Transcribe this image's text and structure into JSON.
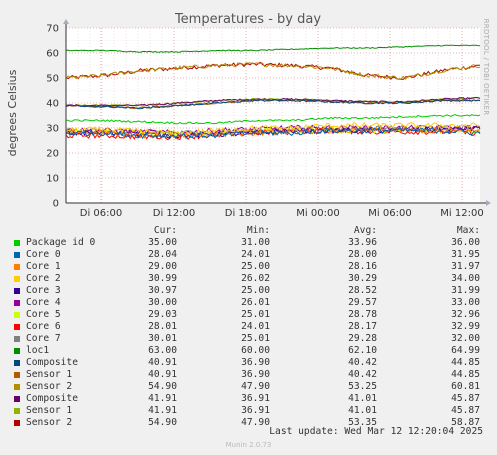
{
  "chart_data": {
    "type": "line",
    "title": "Temperatures - by day",
    "ylabel": "degrees Celsius",
    "side_text": "RRDTOOL / TOBI OETIKER",
    "ylim": [
      0,
      70
    ],
    "y_ticks": [
      0,
      10,
      20,
      30,
      40,
      50,
      60,
      70
    ],
    "x_ticks": [
      "Di 06:00",
      "Di 12:00",
      "Di 18:00",
      "Mi 00:00",
      "Mi 06:00",
      "Mi 12:00"
    ],
    "grid": true,
    "series": [
      {
        "name": "Package id 0",
        "color": "#00cc00",
        "values": [
          33,
          33,
          32.5,
          32,
          32,
          33,
          33,
          34,
          34,
          34.5,
          35,
          35
        ]
      },
      {
        "name": "Core 0",
        "color": "#0066b3",
        "values": [
          28,
          28,
          27,
          27,
          27,
          28,
          28,
          29,
          29,
          29,
          29,
          28
        ]
      },
      {
        "name": "Core 1",
        "color": "#ff8000",
        "values": [
          28,
          28,
          27,
          27,
          27.5,
          28,
          28.5,
          29,
          29,
          29,
          29,
          29
        ]
      },
      {
        "name": "Core 2",
        "color": "#ffcc00",
        "values": [
          29,
          29.5,
          28.5,
          28,
          29,
          30,
          30,
          31,
          31,
          31,
          31,
          31
        ]
      },
      {
        "name": "Core 3",
        "color": "#330099",
        "values": [
          28,
          28,
          27.5,
          27,
          27.5,
          28,
          29,
          29,
          29,
          29,
          29.5,
          30
        ]
      },
      {
        "name": "Core 4",
        "color": "#990099",
        "values": [
          29,
          29,
          28.5,
          28,
          29,
          29.5,
          30,
          30,
          30,
          30,
          30,
          30
        ]
      },
      {
        "name": "Core 5",
        "color": "#ccff00",
        "values": [
          28,
          28.5,
          28,
          27.5,
          28,
          29,
          29,
          29,
          29,
          29,
          29,
          29
        ]
      },
      {
        "name": "Core 6",
        "color": "#ff0000",
        "values": [
          27,
          27,
          26.5,
          26.5,
          27,
          28,
          28.5,
          29,
          28.5,
          28.5,
          28.5,
          28
        ]
      },
      {
        "name": "Core 7",
        "color": "#808080",
        "values": [
          29,
          29,
          28.5,
          28,
          28.5,
          29,
          29.5,
          30,
          30,
          30,
          30,
          30
        ]
      },
      {
        "name": "loc1",
        "color": "#008f00",
        "values": [
          61,
          61,
          60.5,
          60.5,
          61,
          61,
          61.5,
          62,
          62,
          62.5,
          63,
          63
        ]
      },
      {
        "name": "Composite",
        "color": "#00487d",
        "values": [
          39,
          38.5,
          38,
          39,
          40,
          41,
          41,
          40.5,
          40,
          40,
          41,
          41
        ]
      },
      {
        "name": "Sensor 1",
        "color": "#b35a00",
        "values": [
          39,
          38.5,
          38,
          39,
          40,
          41,
          41,
          40.5,
          40,
          40,
          41,
          41
        ]
      },
      {
        "name": "Sensor 2",
        "color": "#b38f00",
        "values": [
          50,
          51,
          53,
          54,
          55,
          55.5,
          55,
          54,
          51,
          50,
          53,
          55
        ]
      },
      {
        "name": "Composite",
        "color": "#6b006b",
        "values": [
          39,
          39,
          39,
          40,
          41,
          41.5,
          41.5,
          41,
          40.5,
          40.5,
          41.5,
          42
        ]
      },
      {
        "name": "Sensor 1",
        "color": "#8fb300",
        "values": [
          39,
          39,
          39,
          40,
          41,
          41.5,
          41.5,
          41,
          40.5,
          40.5,
          41.5,
          42
        ]
      },
      {
        "name": "Sensor 2",
        "color": "#b30000",
        "values": [
          50,
          51,
          53,
          54,
          55,
          55.5,
          55,
          54,
          51,
          50,
          53,
          55
        ]
      }
    ]
  },
  "legend": {
    "headers": [
      "Cur:",
      "Min:",
      "Avg:",
      "Max:"
    ],
    "rows": [
      {
        "name": "Package id 0",
        "color": "#00cc00",
        "cur": "35.00",
        "min": "31.00",
        "avg": "33.96",
        "max": "36.00"
      },
      {
        "name": "Core 0",
        "color": "#0066b3",
        "cur": "28.04",
        "min": "24.01",
        "avg": "28.00",
        "max": "31.95"
      },
      {
        "name": "Core 1",
        "color": "#ff8000",
        "cur": "29.00",
        "min": "25.00",
        "avg": "28.16",
        "max": "31.97"
      },
      {
        "name": "Core 2",
        "color": "#ffcc00",
        "cur": "30.99",
        "min": "26.02",
        "avg": "30.29",
        "max": "34.00"
      },
      {
        "name": "Core 3",
        "color": "#330099",
        "cur": "30.97",
        "min": "25.00",
        "avg": "28.52",
        "max": "31.99"
      },
      {
        "name": "Core 4",
        "color": "#990099",
        "cur": "30.00",
        "min": "26.01",
        "avg": "29.57",
        "max": "33.00"
      },
      {
        "name": "Core 5",
        "color": "#ccff00",
        "cur": "29.03",
        "min": "25.01",
        "avg": "28.78",
        "max": "32.96"
      },
      {
        "name": "Core 6",
        "color": "#ff0000",
        "cur": "28.01",
        "min": "24.01",
        "avg": "28.17",
        "max": "32.99"
      },
      {
        "name": "Core 7",
        "color": "#808080",
        "cur": "30.01",
        "min": "25.01",
        "avg": "29.28",
        "max": "32.00"
      },
      {
        "name": "loc1",
        "color": "#008f00",
        "cur": "63.00",
        "min": "60.00",
        "avg": "62.10",
        "max": "64.99"
      },
      {
        "name": "Composite",
        "color": "#00487d",
        "cur": "40.91",
        "min": "36.90",
        "avg": "40.42",
        "max": "44.85"
      },
      {
        "name": "Sensor 1",
        "color": "#b35a00",
        "cur": "40.91",
        "min": "36.90",
        "avg": "40.42",
        "max": "44.85"
      },
      {
        "name": "Sensor 2",
        "color": "#b38f00",
        "cur": "54.90",
        "min": "47.90",
        "avg": "53.25",
        "max": "60.81"
      },
      {
        "name": "Composite",
        "color": "#6b006b",
        "cur": "41.91",
        "min": "36.91",
        "avg": "41.01",
        "max": "45.87"
      },
      {
        "name": "Sensor 1",
        "color": "#8fb300",
        "cur": "41.91",
        "min": "36.91",
        "avg": "41.01",
        "max": "45.87"
      },
      {
        "name": "Sensor 2",
        "color": "#b30000",
        "cur": "54.90",
        "min": "47.90",
        "avg": "53.35",
        "max": "58.87"
      }
    ]
  },
  "last_update": "Last update: Wed Mar 12 12:20:04 2025",
  "footer": "Munin 2.0.73"
}
